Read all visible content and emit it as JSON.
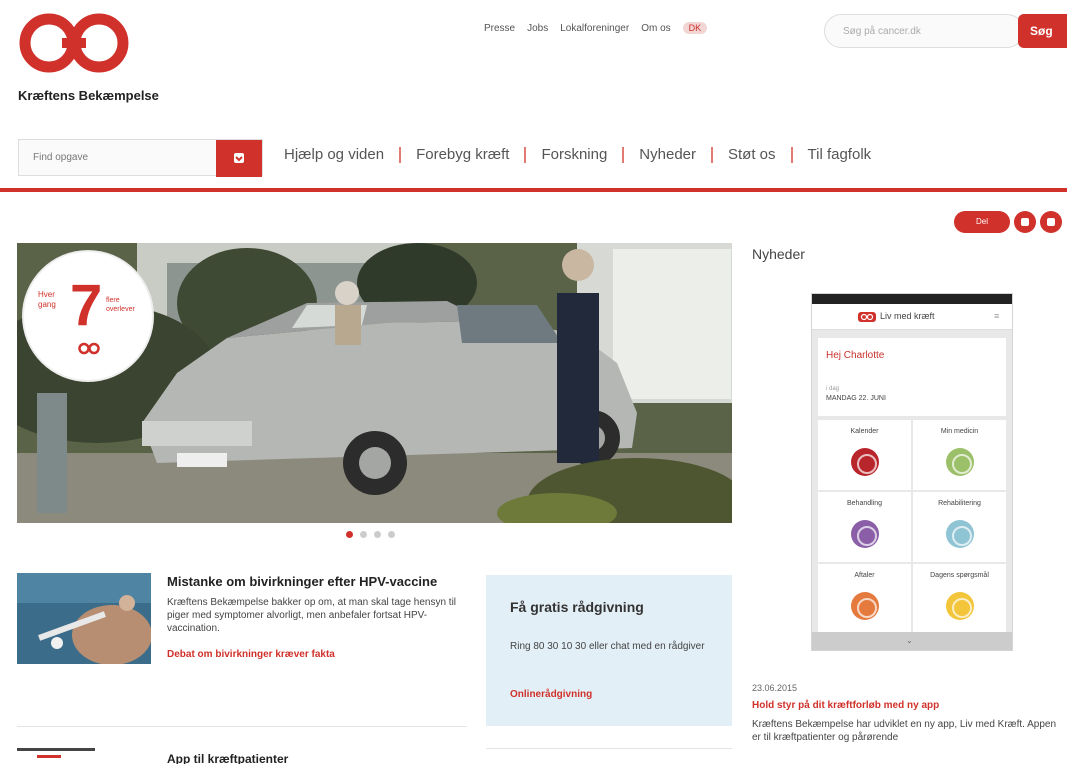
{
  "brand": {
    "name": "Kræftens Bekæmpelse",
    "color": "#d0312b"
  },
  "top_links": [
    "Presse",
    "Jobs",
    "Lokalforeninger",
    "Om os"
  ],
  "lang_toggle": "DK",
  "search": {
    "placeholder": "Søg på cancer.dk",
    "button": "Søg"
  },
  "find": {
    "placeholder": "Find opgave",
    "icon": "chevron-down-icon"
  },
  "nav": [
    "Hjælp og viden",
    "Forebyg kræft",
    "Forskning",
    "Nyheder",
    "Støt os",
    "Til fagfolk"
  ],
  "utility": {
    "pill": "Del",
    "icons": [
      "print-icon",
      "share-icon"
    ]
  },
  "hero": {
    "badge_top": "Hver gang",
    "badge_number": "7",
    "badge_side": "flere overlever",
    "slides": 4,
    "active_slide": 0
  },
  "article1": {
    "title": "Mistanke om bivirkninger efter HPV-vaccine",
    "text": "Kræftens Bekæmpelse bakker op om, at man skal tage hensyn til piger med symptomer alvorligt, men anbefaler fortsat HPV-vaccination.",
    "link": "Debat om bivirkninger kræver fakta"
  },
  "article2": {
    "title": "App til kræftpatienter"
  },
  "advice": {
    "title": "Få gratis rådgivning",
    "text": "Ring 80 30 10 30 eller chat med en rådgiver",
    "link": "Onlinerådgivning"
  },
  "news": {
    "heading": "Nyheder",
    "app": {
      "title": "Liv med kræft",
      "greeting": "Hej Charlotte",
      "date_label": "i dag",
      "date_value": "MANDAG 22. JUNI",
      "tiles": [
        {
          "label": "Kalender",
          "color": "#b8262c"
        },
        {
          "label": "Min medicin",
          "color": "#9cc06a"
        },
        {
          "label": "Behandling",
          "color": "#8a5fa8"
        },
        {
          "label": "Rehabilitering",
          "color": "#8fc4d4"
        },
        {
          "label": "Aftaler",
          "color": "#e47a3e"
        },
        {
          "label": "Dagens spørgsmål",
          "color": "#f2c53a"
        }
      ],
      "footer": "⌄"
    },
    "date": "23.06.2015",
    "title": "Hold styr på dit kræftforløb med ny app",
    "text": "Kræftens Bekæmpelse har udviklet en ny app, Liv med Kræft. Appen er til kræftpatienter og pårørende"
  }
}
